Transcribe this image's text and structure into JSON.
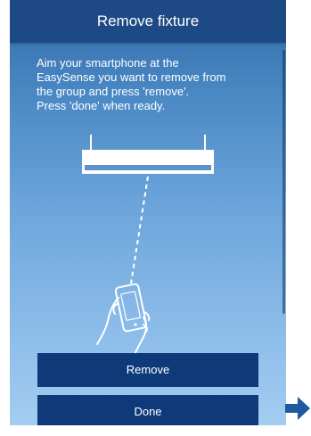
{
  "header": {
    "title": "Remove fixture"
  },
  "instructions": {
    "lines": [
      "Aim your smartphone at the",
      "EasySense you want to remove from",
      "the group and press 'remove'.",
      "Press 'done' when ready."
    ]
  },
  "illustration": {
    "fixture_icon": "ceiling-fixture-icon",
    "beam_icon": "dashed-beam-icon",
    "phone_icon": "hand-holding-phone-icon"
  },
  "buttons": {
    "remove_label": "Remove",
    "done_label": "Done"
  },
  "side_arrow_icon": "arrow-right-icon",
  "colors": {
    "header_bg": "#1d4a84",
    "button_bg": "#0f3a7a",
    "gradient_top": "#2f6aa8",
    "gradient_bottom": "#a3cdf1",
    "arrow": "#1f5aa0"
  }
}
